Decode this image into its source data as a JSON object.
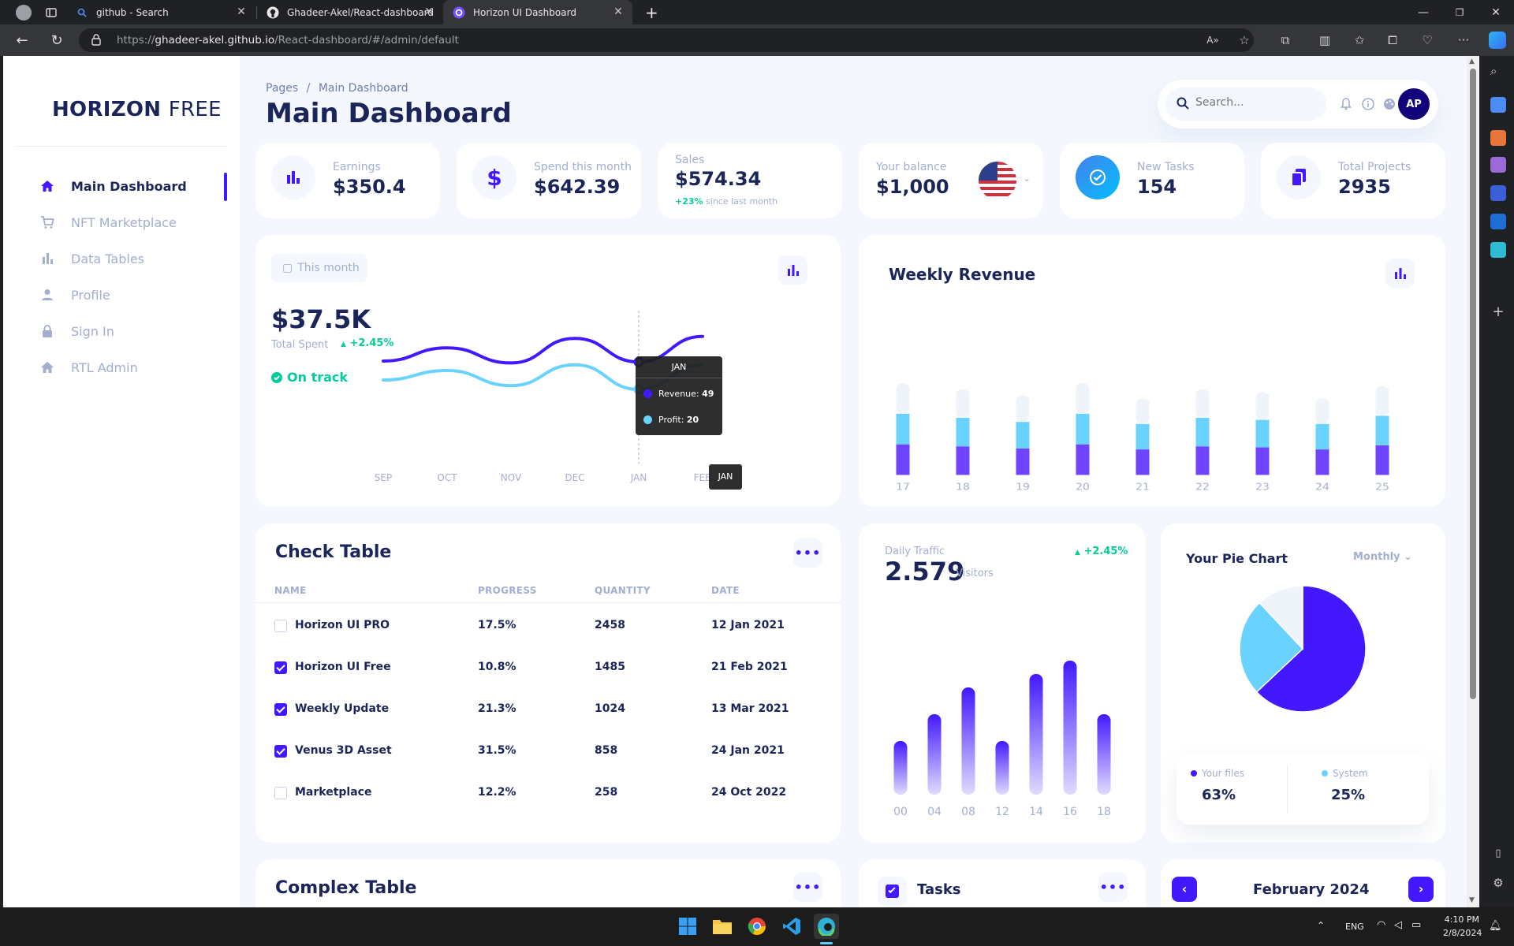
{
  "browser": {
    "tabs": [
      {
        "title": "github - Search"
      },
      {
        "title": "Ghadeer-Akel/React-dashboard"
      },
      {
        "title": "Horizon UI Dashboard"
      }
    ],
    "url_prefix": "https://",
    "url_host": "ghadeer-akel.github.io",
    "url_path": "/React-dashboard/#/admin/default"
  },
  "sidebar": {
    "brand_bold": "HORIZON",
    "brand_light": "FREE",
    "items": [
      {
        "label": "Main Dashboard",
        "icon": "home-icon"
      },
      {
        "label": "NFT Marketplace",
        "icon": "cart-icon"
      },
      {
        "label": "Data Tables",
        "icon": "bar-chart-icon"
      },
      {
        "label": "Profile",
        "icon": "person-icon"
      },
      {
        "label": "Sign In",
        "icon": "lock-icon"
      },
      {
        "label": "RTL Admin",
        "icon": "home-icon"
      }
    ]
  },
  "header": {
    "breadcrumb_root": "Pages",
    "breadcrumb_sep": "/",
    "breadcrumb_current": "Main Dashboard",
    "title": "Main Dashboard",
    "search_placeholder": "Search...",
    "avatar_initials": "AP"
  },
  "stats": [
    {
      "label": "Earnings",
      "value": "$350.4",
      "icon": "bar-chart-icon"
    },
    {
      "label": "Spend this month",
      "value": "$642.39",
      "icon": "dollar-icon"
    },
    {
      "label": "Sales",
      "value": "$574.34",
      "delta": "+23%",
      "delta_text": "since last month"
    },
    {
      "label": "Your balance",
      "value": "$1,000",
      "icon": "us-flag-icon"
    },
    {
      "label": "New Tasks",
      "value": "154",
      "icon": "check-badge-icon"
    },
    {
      "label": "Total Projects",
      "value": "2935",
      "icon": "file-icon"
    }
  ],
  "total_spent": {
    "period_button": "This month",
    "value": "$37.5K",
    "label": "Total Spent",
    "delta": "+2.45%",
    "status": "On track",
    "tooltip_title": "JAN",
    "tooltip_revenue_label": "Revenue:",
    "tooltip_revenue_value": "49",
    "tooltip_profit_label": "Profit:",
    "tooltip_profit_value": "20",
    "crosshair_label": "JAN"
  },
  "weekly_revenue": {
    "title": "Weekly Revenue"
  },
  "check_table": {
    "title": "Check Table",
    "columns": [
      "NAME",
      "PROGRESS",
      "QUANTITY",
      "DATE"
    ],
    "rows": [
      {
        "checked": false,
        "name": "Horizon UI PRO",
        "progress": "17.5%",
        "quantity": "2458",
        "date": "12 Jan 2021"
      },
      {
        "checked": true,
        "name": "Horizon UI Free",
        "progress": "10.8%",
        "quantity": "1485",
        "date": "21 Feb 2021"
      },
      {
        "checked": true,
        "name": "Weekly Update",
        "progress": "21.3%",
        "quantity": "1024",
        "date": "13 Mar 2021"
      },
      {
        "checked": true,
        "name": "Venus 3D Asset",
        "progress": "31.5%",
        "quantity": "858",
        "date": "24 Jan 2021"
      },
      {
        "checked": false,
        "name": "Marketplace",
        "progress": "12.2%",
        "quantity": "258",
        "date": "24 Oct 2022"
      }
    ]
  },
  "daily_traffic": {
    "label": "Daily Traffic",
    "value": "2.579",
    "unit": "Visitors",
    "delta": "+2.45%"
  },
  "pie": {
    "title": "Your Pie Chart",
    "period": "Monthly",
    "legend": [
      {
        "label": "Your files",
        "value": "63%",
        "color": "#4318ff"
      },
      {
        "label": "System",
        "value": "25%",
        "color": "#6ad2ff"
      }
    ]
  },
  "bottom": {
    "complex_table_title": "Complex Table",
    "tasks_title": "Tasks",
    "calendar_month": "February 2024"
  },
  "taskbar": {
    "lang": "ENG",
    "time": "4:10 PM",
    "date": "2/8/2024"
  },
  "colors": {
    "brand": "#4318ff",
    "cyan": "#6ad2ff",
    "navy": "#1b2559",
    "muted": "#a3aed0",
    "green": "#05cd99",
    "bar_bg": "#e9edf7"
  },
  "chart_data": [
    {
      "type": "line",
      "x": [
        "SEP",
        "OCT",
        "NOV",
        "DEC",
        "JAN",
        "FEB"
      ],
      "series": [
        {
          "name": "Revenue",
          "values": [
            50,
            64,
            48,
            74,
            49,
            76
          ]
        },
        {
          "name": "Profit",
          "values": [
            30,
            40,
            24,
            46,
            20,
            46
          ]
        }
      ]
    },
    {
      "type": "bar",
      "title": "Weekly Revenue",
      "categories": [
        "17",
        "18",
        "19",
        "20",
        "21",
        "22",
        "23",
        "24",
        "25"
      ],
      "stacked": true,
      "series": [
        {
          "values": [
            30,
            28,
            26,
            30,
            25,
            28,
            27,
            25,
            29
          ]
        },
        {
          "values": [
            30,
            28,
            26,
            30,
            25,
            28,
            27,
            25,
            29
          ]
        },
        {
          "values": [
            30,
            28,
            26,
            30,
            25,
            28,
            27,
            25,
            29
          ]
        }
      ]
    },
    {
      "type": "bar",
      "title": "Daily Traffic",
      "categories": [
        "00",
        "04",
        "08",
        "12",
        "14",
        "16",
        "18"
      ],
      "values": [
        20,
        30,
        40,
        20,
        45,
        50,
        30
      ]
    },
    {
      "type": "pie",
      "title": "Your Pie Chart",
      "labels": [
        "Your files",
        "System",
        "Empty"
      ],
      "values": [
        63,
        25,
        12
      ]
    }
  ]
}
